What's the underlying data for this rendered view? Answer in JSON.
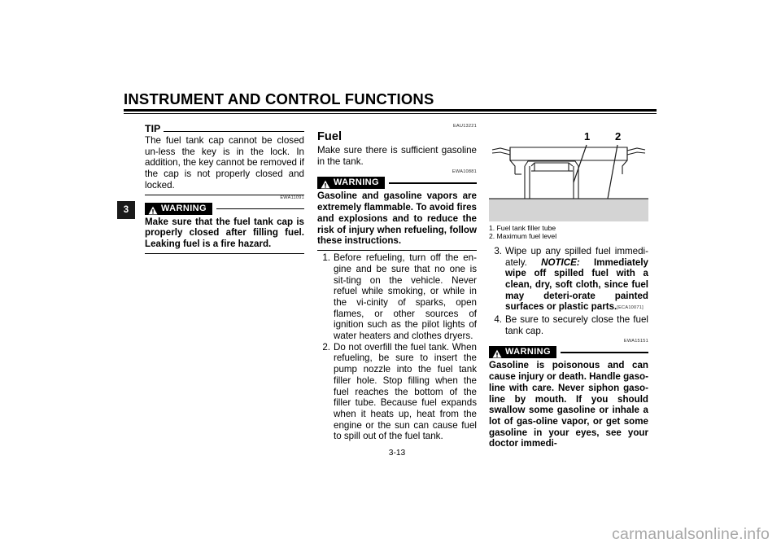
{
  "header": {
    "title": "INSTRUMENT AND CONTROL FUNCTIONS"
  },
  "chapter_tab": {
    "number": "3"
  },
  "column_left": {
    "tip": {
      "label": "TIP",
      "text": "The fuel tank cap cannot be closed un-less the key is in the lock. In addition, the key cannot be removed if the cap is not properly closed and locked."
    },
    "ref_code_warning": "EWA11091",
    "warning": {
      "badge_label": "WARNING",
      "text": "Make sure that the fuel tank cap is properly closed after filling fuel. Leaking fuel is a fire hazard."
    }
  },
  "column_middle": {
    "ref_code_section": "EAU13221",
    "section_title": "Fuel",
    "intro_text": "Make sure there is sufficient gasoline in the tank.",
    "ref_code_warning": "EWA10881",
    "warning": {
      "badge_label": "WARNING",
      "text": "Gasoline and gasoline vapors are extremely flammable. To avoid fires and explosions and to reduce the risk of injury when refueling, follow these instructions."
    },
    "list": [
      {
        "marker": "1.",
        "text": "Before refueling, turn off the en-gine and be sure that no one is sit-ting on the vehicle. Never refuel while smoking, or while in the vi-cinity of sparks, open flames, or other sources of ignition such as the pilot lights of water heaters and clothes dryers."
      },
      {
        "marker": "2.",
        "text": "Do not overfill the fuel tank. When refueling, be sure to insert the pump nozzle into the fuel tank filler hole. Stop filling when the fuel reaches the bottom of the filler tube. Because fuel expands when it heats up, heat from the engine or the sun can cause fuel to spill out of the fuel tank."
      }
    ]
  },
  "column_right": {
    "figure": {
      "callout_1": "1",
      "callout_2": "2",
      "caption": [
        "1. Fuel tank filler tube",
        "2. Maximum fuel level"
      ]
    },
    "list": [
      {
        "marker": "3.",
        "text_plain": "Wipe up any spilled fuel immedi-ately. ",
        "notice_label": "NOTICE:",
        "text_bold": " Immediately wipe off spilled fuel with a clean, dry, soft cloth, since fuel may deteri-orate painted surfaces or plastic parts.",
        "ref_code": "[ECA10071]"
      },
      {
        "marker": "4.",
        "text_plain": "Be sure to securely close the fuel tank cap."
      }
    ],
    "ref_code_warning": "EWA15151",
    "warning": {
      "badge_label": "WARNING",
      "text": "Gasoline is poisonous and can cause injury or death. Handle gaso-line with care. Never siphon gaso-line by mouth. If you should swallow some gasoline or inhale a lot of gas-oline vapor, or get some gasoline in your eyes, see your doctor immedi-"
    }
  },
  "footer": {
    "page_number": "3-13",
    "watermark": "carmanualsonline.info"
  },
  "colors": {
    "ink": "#000000",
    "figure_ground": "#d4d4d4",
    "watermark": "#a8a8a8"
  }
}
